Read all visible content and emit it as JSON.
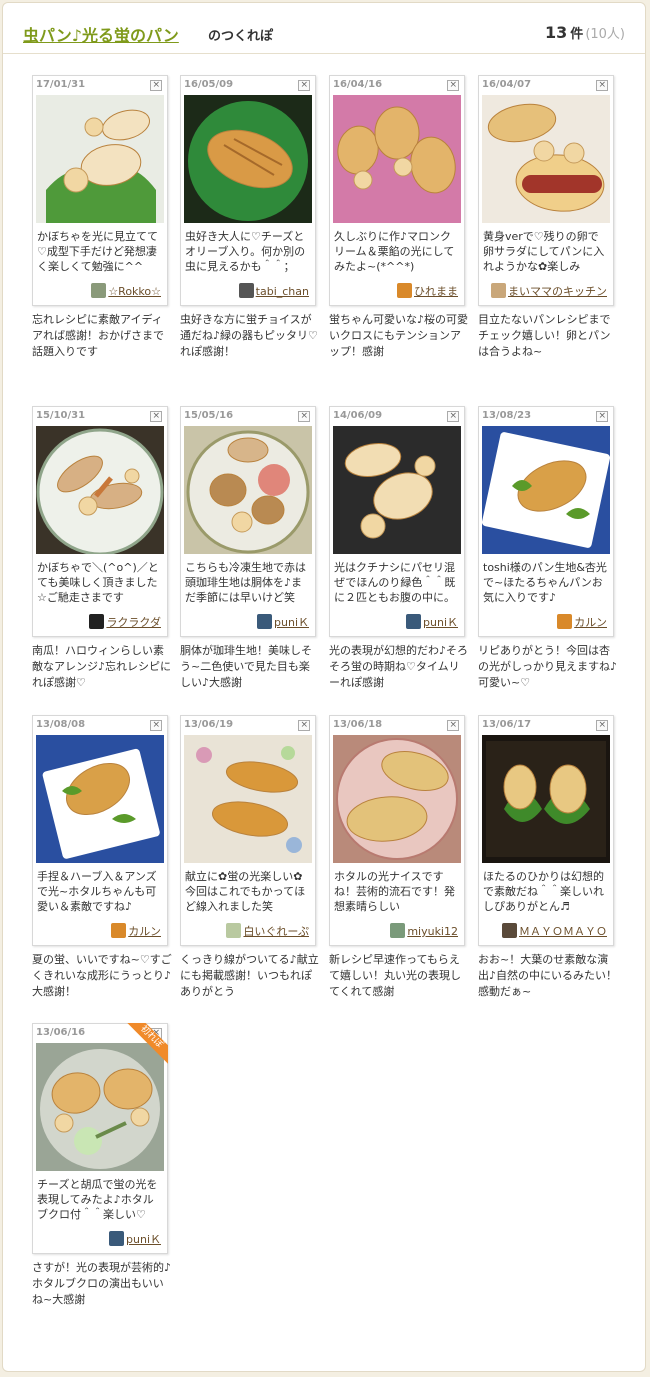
{
  "header": {
    "recipe_title": "虫パン♪光る蛍のパン",
    "suffix": "のつくれぽ",
    "count": "13",
    "count_unit": "件",
    "people": "(10人)"
  },
  "close_label": "×",
  "first_report_badge": "初れぽ",
  "reports": [
    {
      "date": "17/01/31",
      "comment": "かぼちゃを光に見立てて♡成型下手だけど発想凄く楽しくて勉強に^^",
      "author": "☆Rokko☆",
      "reply": "忘れレシピに素敵アイディアれば感謝！おかげさまで話題入りです",
      "photo": "bun-lettuce",
      "icon_color": "#8a9a7a"
    },
    {
      "date": "16/05/09",
      "comment": "虫好き大人に♡チーズとオリーブ入り。何か別の虫に見えるかも＾＾；",
      "author": "tabi_chan",
      "reply": "虫好きな方に蛍チョイスが通だね♪緑の器もピッタリ♡れぽ感謝！",
      "photo": "bun-greenplate",
      "icon_color": "#555"
    },
    {
      "date": "16/04/16",
      "comment": "久しぶりに作♪マロンクリーム＆栗餡の光にしてみたよ~(*^^*)",
      "author": "ひれまま",
      "reply": "蛍ちゃん可愛いな♪桜の可愛いクロスにもテンションアップ！感謝",
      "photo": "bun-pink",
      "icon_color": "#d9892a"
    },
    {
      "date": "16/04/07",
      "comment": "黄身verで♡残りの卵で卵サラダにしてパンに入れようかな✿楽しみ",
      "author": "まいママのキッチン",
      "reply": "目立たないパンレシピまでチェック嬉しい！卵とパンは合うよね~",
      "photo": "bun-hotdog",
      "icon_color": "#c9a77a"
    },
    {
      "date": "15/10/31",
      "comment": "かぼちゃで＼(^o^)／とても美味しく頂きました☆ご馳走さまです",
      "author": "ラクラクダ",
      "reply": "南瓜！ハロウィンらしい素敵なアレンジ♪忘れレシピにれぽ感謝♡",
      "photo": "bun-halloween",
      "icon_color": "#222"
    },
    {
      "date": "15/05/16",
      "comment": "こちらも冷凍生地で赤は頭珈琲生地は胴体を♪まだ季節には早いけど笑",
      "author": "puniＫ",
      "reply": "胴体が珈琲生地！美味しそう~二色使いで見た目も楽しい♪大感謝",
      "photo": "bun-ladybug",
      "icon_color": "#3a5a7a"
    },
    {
      "date": "14/06/09",
      "comment": "光はクチナシにパセリ混ぜでほんのり緑色＾＾既に２匹ともお腹の中に。",
      "author": "puniＫ",
      "reply": "光の表現が幻想的だわ♪そろそろ蛍の時期ね♡タイムリーれぽ感謝",
      "photo": "bun-dark",
      "icon_color": "#3a5a7a"
    },
    {
      "date": "13/08/23",
      "comment": "toshi様のパン生地&杏光で~ほたるちゃんパンお気に入りです♪",
      "author": "カルン",
      "reply": "リピありがとう！今回は杏の光がしっかり見えますね♪可愛い~♡",
      "photo": "bun-blue",
      "icon_color": "#d9892a"
    },
    {
      "date": "13/08/08",
      "comment": "手捏＆ハーブ入＆アンズで光~ホタルちゃんも可愛い＆素敵ですね♪",
      "author": "カルン",
      "reply": "夏の蛍、いいですね~♡すごくきれいな成形にうっとり♪大感謝！",
      "photo": "bun-blue2",
      "icon_color": "#d9892a"
    },
    {
      "date": "13/06/19",
      "comment": "献立に✿蛍の光楽しい✿今回はこれでもかってほど線入れました笑",
      "author": "白いぐれーぷ",
      "reply": "くっきり線がついてる♪献立にも掲載感謝！いつもれぽありがとう",
      "photo": "bun-floral",
      "icon_color": "#b9c9a0"
    },
    {
      "date": "13/06/18",
      "comment": "ホタルの光ナイスですね！芸術的流石です！発想素晴らしい",
      "author": "miyuki12",
      "reply": "新レシピ早速作ってもらえて嬉しい！丸い光の表現してくれて感謝",
      "photo": "bun-pinkplate",
      "icon_color": "#7a9a7a"
    },
    {
      "date": "13/06/17",
      "comment": "ほたるのひかりは幻想的で素敵だね＾＾楽しいれしぴありがとん♬",
      "author": "ＭＡＹＯＭＡＹＯ",
      "reply": "おお~！大葉のせ素敵な演出♪自然の中にいるみたい！感動だぁ~",
      "photo": "bun-shiso",
      "icon_color": "#5a4a3a"
    },
    {
      "date": "13/06/16",
      "comment": "チーズと胡瓜で蛍の光を表現してみたよ♪ホタルブクロ付＾＾楽しい♡",
      "author": "puniＫ",
      "reply": "さすが！光の表現が芸術的♪ホタルブクロの演出もいいね~大感謝",
      "photo": "bun-first",
      "icon_color": "#3a5a7a",
      "first": true
    }
  ]
}
